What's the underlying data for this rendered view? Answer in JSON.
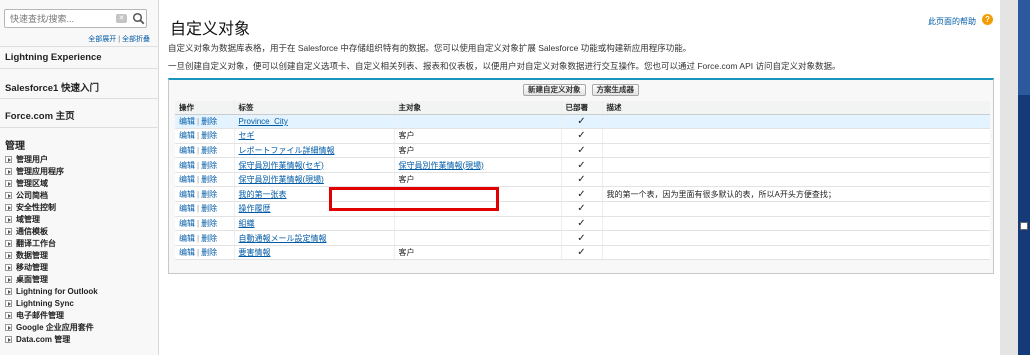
{
  "sidebar": {
    "search_placeholder": "快速查找/搜索...",
    "expand_all": "全部展开",
    "divider": "|",
    "collapse_all": "全部折叠",
    "sections": [
      "Lightning Experience",
      "Salesforce1 快速入门",
      "Force.com 主页"
    ],
    "admin_title": "管理",
    "tree_items": [
      "管理用户",
      "管理应用程序",
      "管理区域",
      "公司简档",
      "安全性控制",
      "域管理",
      "通信模板",
      "翻译工作台",
      "数据管理",
      "移动管理",
      "桌面管理",
      "Lightning for Outlook",
      "Lightning Sync",
      "电子邮件管理",
      "Google 企业应用套件",
      "Data.com 管理"
    ]
  },
  "page": {
    "title": "自定义对象",
    "help_link": "此页面的帮助",
    "help_icon": "?",
    "desc1": "自定义对象为数据库表格，用于在 Salesforce 中存储组织特有的数据。您可以使用自定义对象扩展 Salesforce 功能或构建新应用程序功能。",
    "desc2": "一旦创建自定义对象，便可以创建自定义选项卡、自定义相关列表、报表和仪表板，以便用户对自定义对象数据进行交互操作。您也可以通过 Force.com API 访问自定义对象数据。"
  },
  "buttons": {
    "new_object": "新建自定义对象",
    "schema_builder": "方案生成器"
  },
  "table": {
    "headers": {
      "action": "操作",
      "label": "标签",
      "master": "主对象",
      "deployed": "已部署",
      "description": "描述"
    },
    "edit": "编辑",
    "sep": "|",
    "del": "删除",
    "check": "✓",
    "rows": [
      {
        "label": "Province_City",
        "master": "",
        "description": ""
      },
      {
        "label": "セギ",
        "master": "客户",
        "description": ""
      },
      {
        "label": "レポートファイル詳細情報",
        "master": "客户",
        "description": ""
      },
      {
        "label": "保守員別作業情報(セギ)",
        "master": "保守員別作業情報(現場)",
        "description": ""
      },
      {
        "label": "保守員別作業情報(現場)",
        "master": "客户",
        "description": ""
      },
      {
        "label": "我的第一张表",
        "master": "",
        "description": "我的第一个表，因为里面有很多默认的表，所以A开头方便查找；"
      },
      {
        "label": "操作履歴",
        "master": "",
        "description": ""
      },
      {
        "label": "組織",
        "master": "",
        "description": ""
      },
      {
        "label": "自動通報メール設定情報",
        "master": "",
        "description": ""
      },
      {
        "label": "要害情報",
        "master": "客户",
        "description": ""
      }
    ]
  }
}
